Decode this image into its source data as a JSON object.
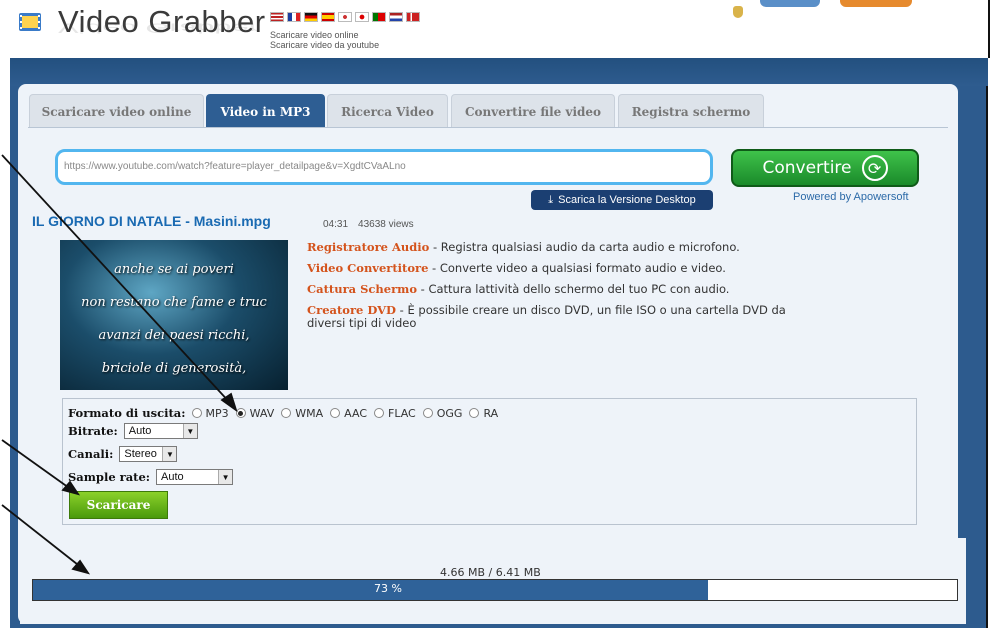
{
  "header": {
    "app_name": "Video Grabber",
    "subtitle_1": "Scaricare video online",
    "subtitle_2": "Scaricare video da youtube",
    "flags": [
      "flag-us",
      "flag-fr",
      "flag-de",
      "flag-es",
      "flag-kr",
      "flag-jp",
      "flag-pt",
      "flag-nl",
      "flag-no"
    ],
    "logo_icon": "film-icon"
  },
  "tabs": [
    {
      "label": "Scaricare video online",
      "active": false
    },
    {
      "label": "Video in MP3",
      "active": true
    },
    {
      "label": "Ricerca Video",
      "active": false
    },
    {
      "label": "Convertire file video",
      "active": false
    },
    {
      "label": "Registra schermo",
      "active": false
    }
  ],
  "url_input": {
    "value": "https://www.youtube.com/watch?feature=player_detailpage&v=XgdtCVaALno"
  },
  "convert_button": {
    "label": "Convertire",
    "icon": "refresh-icon"
  },
  "powered_by": "Powered by Apowersoft",
  "desktop_button": {
    "label": "Scarica la Versione Desktop",
    "icon": "download-icon"
  },
  "video": {
    "title": "IL GIORNO DI NATALE - Masini.mpg",
    "duration": "04:31",
    "views": "43638 views",
    "thumbnail_lines": [
      "anche se ai poveri",
      "non restano che fame e truc",
      "avanzi dei paesi ricchi,",
      "briciole di generosità,"
    ]
  },
  "features": [
    {
      "name": "Registratore Audio",
      "desc": " - Registra qualsiasi audio da carta audio e microfono."
    },
    {
      "name": "Video Convertitore",
      "desc": " - Converte video a qualsiasi formato audio e video."
    },
    {
      "name": "Cattura Schermo",
      "desc": " - Cattura lattività dello schermo del tuo PC con audio."
    },
    {
      "name": "Creatore DVD",
      "desc": " - È possibile creare un disco DVD, un file ISO o una cartella DVD da diversi tipi di video"
    }
  ],
  "options": {
    "format_label": "Formato di uscita:",
    "formats": [
      "MP3",
      "WAV",
      "WMA",
      "AAC",
      "FLAC",
      "OGG",
      "RA"
    ],
    "selected_format": "WAV",
    "bitrate_label": "Bitrate:",
    "bitrate_value": "Auto",
    "channels_label": "Canali:",
    "channels_value": "Stereo",
    "samplerate_label": "Sample rate:",
    "samplerate_value": "Auto"
  },
  "download_button": {
    "label": "Scaricare"
  },
  "progress": {
    "size_text": "4.66 MB / 6.41 MB",
    "percent_text": "73 %",
    "fraction": 0.73
  }
}
